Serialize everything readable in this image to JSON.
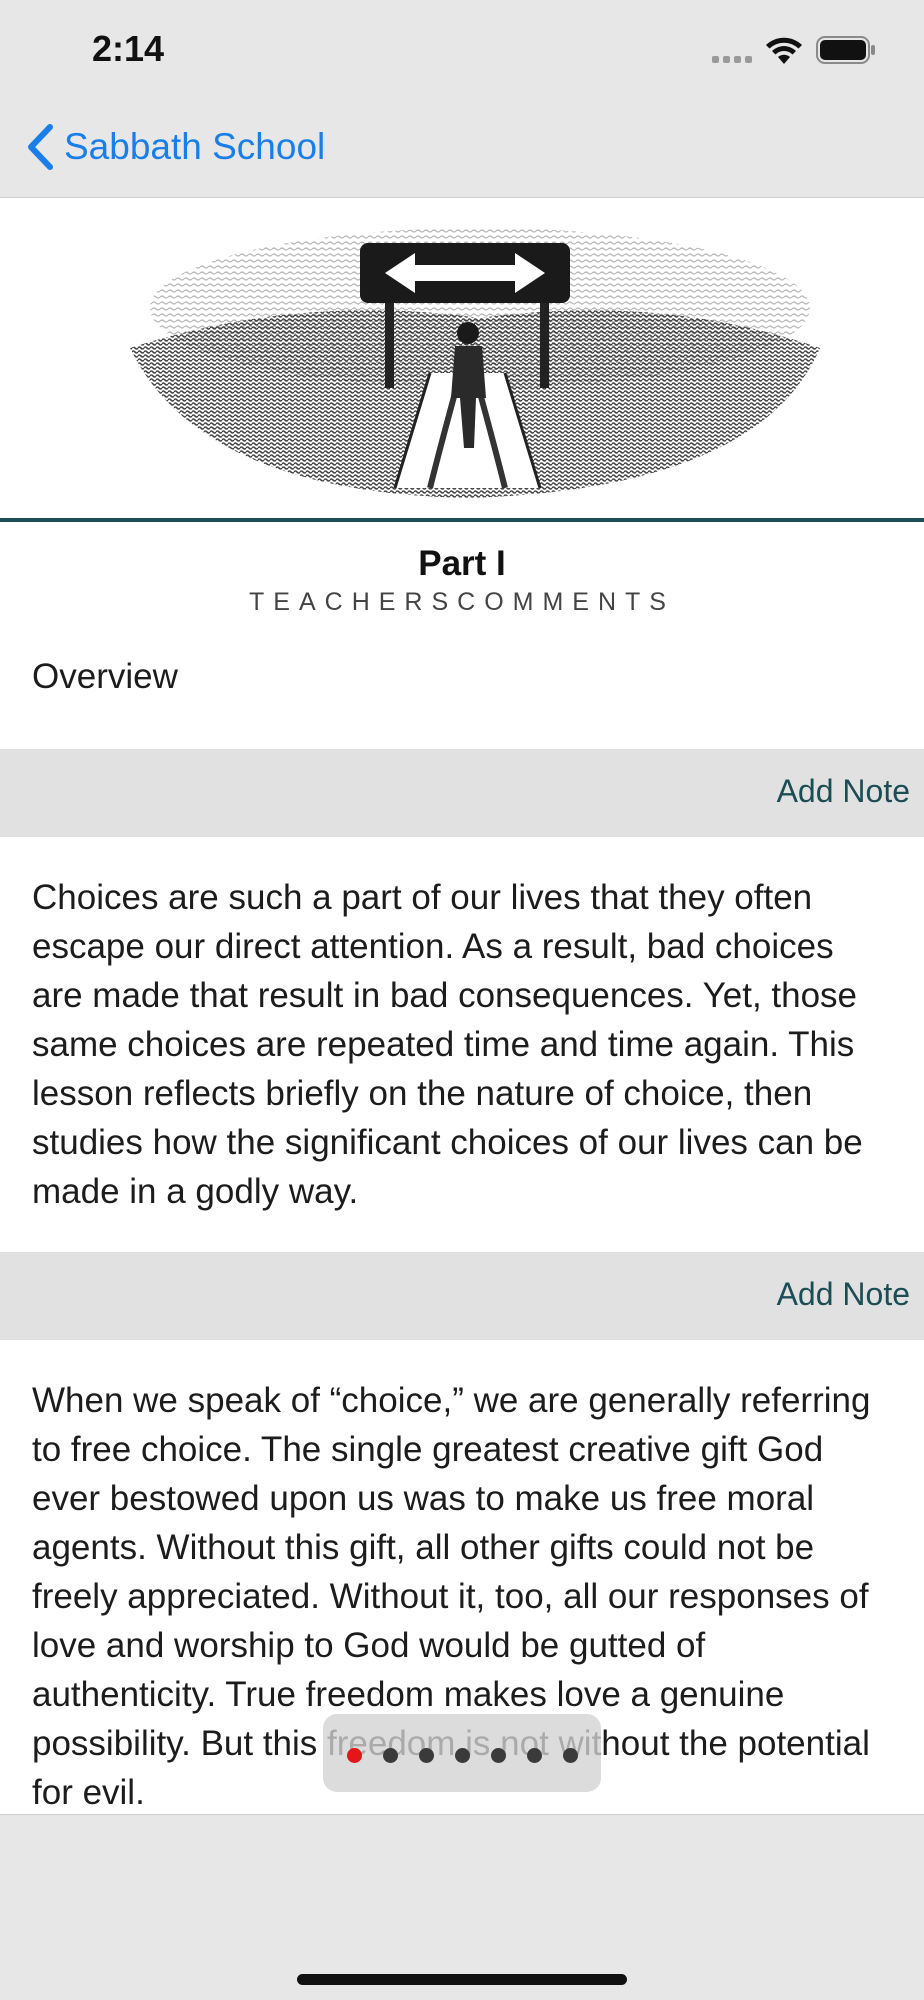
{
  "status_bar": {
    "time": "2:14"
  },
  "nav": {
    "back_label": "Sabbath School"
  },
  "lesson": {
    "part_title": "Part I",
    "part_subtitle": "TEACHERSCOMMENTS",
    "overview_heading": "Overview",
    "add_note_label": "Add Note",
    "paragraphs": [
      "Choices are such a part of our lives that they often escape our direct attention. As a result, bad choices are made that result in bad consequences. Yet, those same choices are repeated time and time again. This lesson reflects briefly on the nature of choice, then studies how the significant choices of our lives can be made in a godly way.",
      "When we speak of “choice,” we are generally referring to free choice. The single greatest creative gift God ever bestowed upon us was to make us free moral agents. Without this gift, all other gifts could not be freely appreciated. Without it, too, all our responses of love and worship to God would be gutted of authenticity. True freedom makes love a genuine possibility. But this freedom is not without the potential for evil."
    ]
  },
  "pager": {
    "total": 7,
    "active_index": 0
  },
  "colors": {
    "accent": "#1a7ee8",
    "teal": "#1b4d55",
    "active_dot": "#e3161a"
  },
  "icons": {
    "back": "chevron-left-icon",
    "signal": "cellular-signal-icon",
    "wifi": "wifi-icon",
    "battery": "battery-icon",
    "hero": "crossroads-illustration"
  }
}
